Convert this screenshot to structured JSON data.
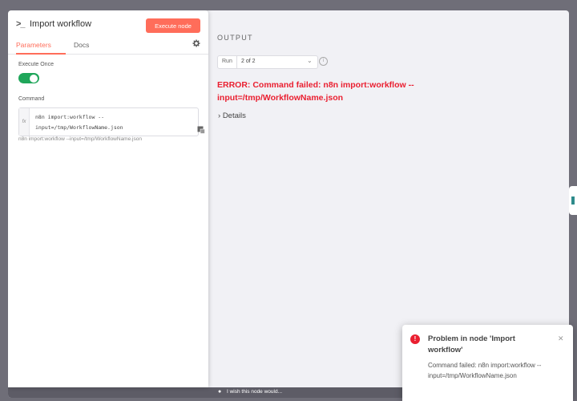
{
  "node_panel": {
    "title": "Import workflow",
    "execute_button": "Execute node",
    "tabs": [
      "Parameters",
      "Docs"
    ],
    "execute_once_label": "Execute Once",
    "execute_once_on": true,
    "command_label": "Command",
    "command_line1": "n8n import:workflow --",
    "command_line2": "input=/tmp/WorkflowName.json",
    "command_hint": "n8n import:workflow --input=/tmp/WorkflowName.json",
    "fx_label": "fx"
  },
  "output": {
    "title": "OUTPUT",
    "run_label": "Run",
    "run_value": "2 of 2",
    "error_message": "ERROR: Command failed: n8n import:workflow --input=/tmp/WorkflowName.json",
    "details_label": "Details"
  },
  "bottom_bar": {
    "wish_text": "I wish this node would..."
  },
  "toast": {
    "title": "Problem in node 'Import workflow'",
    "body": "Command failed: n8n import:workflow --input=/tmp/WorkflowName.json"
  },
  "colors": {
    "accent": "#ff6d5a",
    "error": "#ea1f30",
    "toggle_on": "#1fa65a"
  },
  "icons": [
    "terminal-icon",
    "gear-icon",
    "expand-icon",
    "chevron-down-icon",
    "info-icon",
    "chevron-right-icon",
    "bulb-icon",
    "error-icon",
    "close-icon"
  ]
}
